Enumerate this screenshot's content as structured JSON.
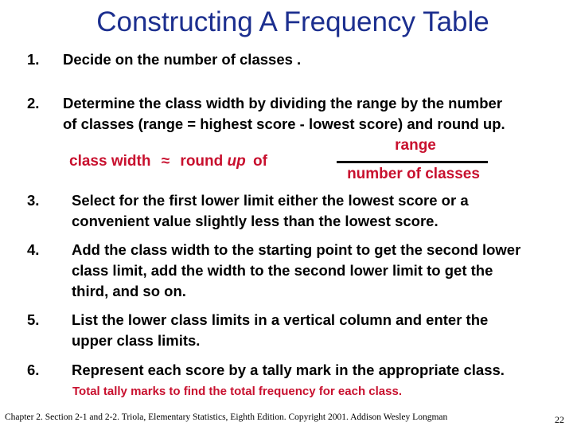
{
  "slide": {
    "title": "Constructing A  Frequency Table",
    "steps": [
      {
        "num": "1.",
        "lines": [
          "Decide on the number of classes ."
        ]
      },
      {
        "num": "2.",
        "lines": [
          "Determine the class width by dividing the range by the number",
          "of classes  (range =  highest score -  lowest score) and round up."
        ]
      },
      {
        "num": "3.",
        "lines": [
          "Select for the first lower limit either the lowest score or a",
          "convenient value slightly less than the lowest score."
        ]
      },
      {
        "num": "4.",
        "lines": [
          "Add the class width to the starting point to get the second lower",
          "class limit, add the width to the second lower limit to get the",
          "third, and so on."
        ]
      },
      {
        "num": "5.",
        "lines": [
          "List  the lower class limits in a vertical column and enter the",
          "upper class limits."
        ]
      },
      {
        "num": "6.",
        "lines": [
          "Represent each score by a tally mark in the appropriate class."
        ]
      }
    ],
    "formula": {
      "lhs_prefix": "class width",
      "approx_symbol": "≈",
      "round": "round",
      "up": "up",
      "of": "of",
      "numerator": "range",
      "denominator": "number of classes"
    },
    "note": "Total tally marks to find the total frequency for each class.",
    "footer": "Chapter 2.  Section 2-1 and 2-2. Triola, Elementary Statistics, Eighth Edition. Copyright  2001.  Addison Wesley Longman",
    "page_number": "22"
  }
}
